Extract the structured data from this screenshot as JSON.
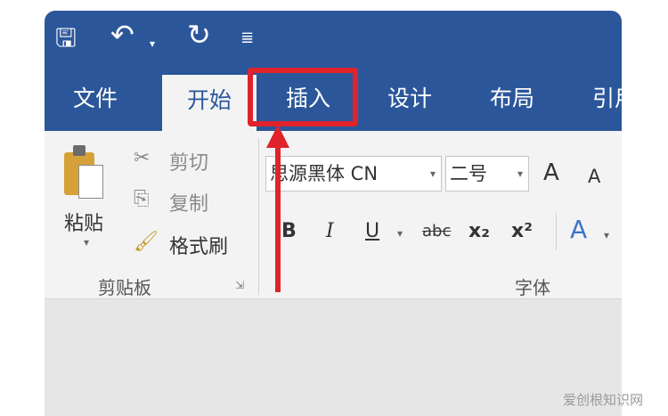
{
  "quick_access": {
    "save_icon": "save-icon",
    "undo_icon": "undo-icon",
    "redo_icon": "redo-icon",
    "customize_icon": "customize-icon"
  },
  "tabs": [
    {
      "label": "文件"
    },
    {
      "label": "开始"
    },
    {
      "label": "插入"
    },
    {
      "label": "设计"
    },
    {
      "label": "布局"
    },
    {
      "label": "引用"
    }
  ],
  "clipboard": {
    "paste_label": "粘贴",
    "cut_label": "剪切",
    "copy_label": "复制",
    "format_painter_label": "格式刷",
    "group_label": "剪贴板"
  },
  "font": {
    "font_name": "思源黑体 CN",
    "font_size": "二号",
    "grow_label": "A",
    "shrink_label": "A",
    "bold": "B",
    "italic": "I",
    "underline": "U",
    "strike": "abc",
    "subscript": "x₂",
    "superscript": "x²",
    "text_effects": "A",
    "group_label": "字体"
  },
  "colors": {
    "ribbon_blue": "#2b579a",
    "highlight_red": "#e0232b"
  },
  "watermark": "爱创根知识网"
}
